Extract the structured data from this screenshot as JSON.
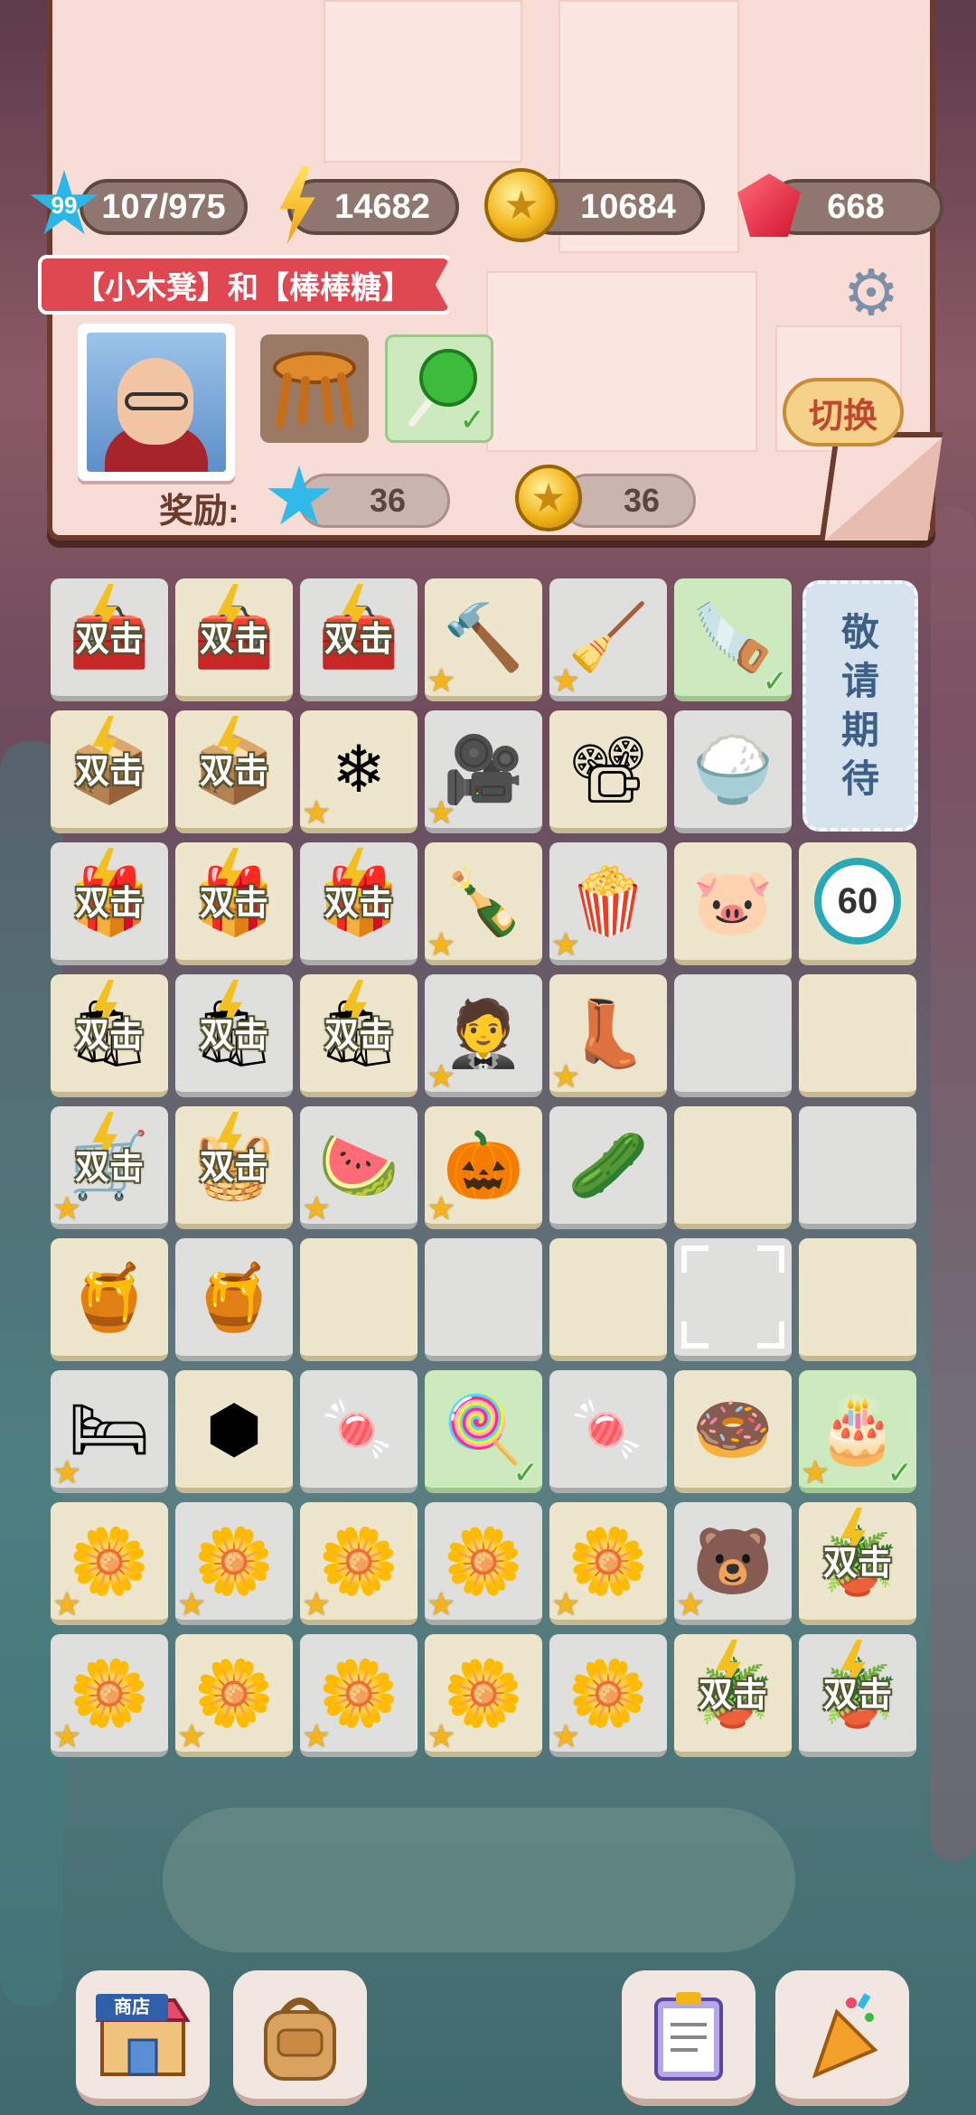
{
  "stats": {
    "level": "99",
    "xp": "107/975",
    "energy": "14682",
    "coins": "10684",
    "gems": "668"
  },
  "task": {
    "title": "【小木凳】和【棒棒糖】",
    "switch_label": "切换",
    "reward_label": "奖励:",
    "reward_xp": "36",
    "reward_coins": "36"
  },
  "board": {
    "double_label": "双击",
    "coming_soon": [
      "敬",
      "请",
      "期",
      "待"
    ],
    "timer_value": "60",
    "cells": [
      {
        "row": 0,
        "col": 0,
        "item": "toolbox-crate",
        "double": true,
        "bg": "grey"
      },
      {
        "row": 0,
        "col": 1,
        "item": "toolbox-crate",
        "double": true,
        "bg": "beige"
      },
      {
        "row": 0,
        "col": 2,
        "item": "toolbox-crate",
        "double": true,
        "bg": "grey"
      },
      {
        "row": 0,
        "col": 3,
        "item": "power-drill",
        "star": true,
        "bg": "beige"
      },
      {
        "row": 0,
        "col": 4,
        "item": "vacuum-cleaner",
        "star": true,
        "bg": "grey"
      },
      {
        "row": 0,
        "col": 5,
        "item": "hand-saw",
        "check": true,
        "bg": "green"
      },
      {
        "row": 1,
        "col": 0,
        "item": "electronics-crate",
        "double": true,
        "bg": "beige"
      },
      {
        "row": 1,
        "col": 1,
        "item": "electronics-crate",
        "double": true,
        "bg": "beige"
      },
      {
        "row": 1,
        "col": 2,
        "item": "air-conditioner",
        "star": true,
        "bg": "beige"
      },
      {
        "row": 1,
        "col": 3,
        "item": "video-camera",
        "star": true,
        "bg": "grey"
      },
      {
        "row": 1,
        "col": 4,
        "item": "projector",
        "bg": "beige"
      },
      {
        "row": 1,
        "col": 5,
        "item": "rice-cooker",
        "bg": "grey"
      },
      {
        "row": 2,
        "col": 0,
        "item": "snack-box",
        "double": true,
        "bg": "grey"
      },
      {
        "row": 2,
        "col": 1,
        "item": "snack-box",
        "double": true,
        "bg": "beige"
      },
      {
        "row": 2,
        "col": 2,
        "item": "snack-box",
        "double": true,
        "bg": "grey"
      },
      {
        "row": 2,
        "col": 3,
        "item": "champagne-bottles",
        "star": true,
        "bg": "beige"
      },
      {
        "row": 2,
        "col": 4,
        "item": "popcorn",
        "star": true,
        "bg": "grey"
      },
      {
        "row": 2,
        "col": 5,
        "item": "piggy-bank",
        "bg": "beige"
      },
      {
        "row": 2,
        "col": 6,
        "item": "timer",
        "bg": "beige"
      },
      {
        "row": 3,
        "col": 0,
        "item": "shopping-bags",
        "double": true,
        "bg": "beige"
      },
      {
        "row": 3,
        "col": 1,
        "item": "shopping-bags",
        "double": true,
        "bg": "grey"
      },
      {
        "row": 3,
        "col": 2,
        "item": "shopping-bags",
        "double": true,
        "bg": "beige"
      },
      {
        "row": 3,
        "col": 3,
        "item": "suit",
        "star": true,
        "bg": "grey"
      },
      {
        "row": 3,
        "col": 4,
        "item": "boots",
        "star": true,
        "bg": "beige"
      },
      {
        "row": 3,
        "col": 5,
        "item": "empty",
        "bg": "grey"
      },
      {
        "row": 3,
        "col": 6,
        "item": "empty",
        "bg": "beige"
      },
      {
        "row": 4,
        "col": 0,
        "item": "shopping-cart",
        "double": true,
        "star": true,
        "bg": "grey"
      },
      {
        "row": 4,
        "col": 1,
        "item": "vegetable-basket",
        "double": true,
        "bg": "beige"
      },
      {
        "row": 4,
        "col": 2,
        "item": "watermelon",
        "star": true,
        "bg": "grey"
      },
      {
        "row": 4,
        "col": 3,
        "item": "pumpkin",
        "star": true,
        "bg": "beige"
      },
      {
        "row": 4,
        "col": 4,
        "item": "cucumber",
        "bg": "grey"
      },
      {
        "row": 4,
        "col": 5,
        "item": "empty",
        "bg": "beige"
      },
      {
        "row": 4,
        "col": 6,
        "item": "empty",
        "bg": "grey"
      },
      {
        "row": 5,
        "col": 0,
        "item": "honeycomb-pieces",
        "bg": "beige"
      },
      {
        "row": 5,
        "col": 1,
        "item": "honey-jar",
        "bg": "grey"
      },
      {
        "row": 5,
        "col": 2,
        "item": "empty",
        "bg": "beige"
      },
      {
        "row": 5,
        "col": 3,
        "item": "empty",
        "bg": "grey"
      },
      {
        "row": 5,
        "col": 4,
        "item": "empty",
        "bg": "beige"
      },
      {
        "row": 5,
        "col": 5,
        "item": "selected",
        "bg": "grey"
      },
      {
        "row": 5,
        "col": 6,
        "item": "empty",
        "bg": "beige"
      },
      {
        "row": 6,
        "col": 0,
        "item": "bed",
        "star": true,
        "bg": "grey"
      },
      {
        "row": 6,
        "col": 1,
        "item": "honeycomb",
        "bg": "beige"
      },
      {
        "row": 6,
        "col": 2,
        "item": "jelly-beans",
        "bg": "grey"
      },
      {
        "row": 6,
        "col": 3,
        "item": "lollipop",
        "check": true,
        "bg": "green"
      },
      {
        "row": 6,
        "col": 4,
        "item": "candy-cane",
        "bg": "grey"
      },
      {
        "row": 6,
        "col": 5,
        "item": "donut",
        "bg": "beige"
      },
      {
        "row": 6,
        "col": 6,
        "item": "cake",
        "star": true,
        "check": true,
        "bg": "green"
      },
      {
        "row": 7,
        "col": 0,
        "item": "flower-generator",
        "star": true,
        "bg": "beige"
      },
      {
        "row": 7,
        "col": 1,
        "item": "flower-generator",
        "star": true,
        "bg": "grey"
      },
      {
        "row": 7,
        "col": 2,
        "item": "flower-generator",
        "star": true,
        "bg": "beige"
      },
      {
        "row": 7,
        "col": 3,
        "item": "flower-generator",
        "star": true,
        "bg": "grey"
      },
      {
        "row": 7,
        "col": 4,
        "item": "flower-generator",
        "star": true,
        "bg": "beige"
      },
      {
        "row": 7,
        "col": 5,
        "item": "bear",
        "star": true,
        "bg": "grey"
      },
      {
        "row": 7,
        "col": 6,
        "item": "flower-pot",
        "double": true,
        "bg": "beige"
      },
      {
        "row": 8,
        "col": 0,
        "item": "flower-generator",
        "star": true,
        "bg": "grey"
      },
      {
        "row": 8,
        "col": 1,
        "item": "flower-generator",
        "star": true,
        "bg": "beige"
      },
      {
        "row": 8,
        "col": 2,
        "item": "flower-generator",
        "star": true,
        "bg": "grey"
      },
      {
        "row": 8,
        "col": 3,
        "item": "flower-generator",
        "star": true,
        "bg": "beige"
      },
      {
        "row": 8,
        "col": 4,
        "item": "flower-generator",
        "star": true,
        "bg": "grey"
      },
      {
        "row": 8,
        "col": 5,
        "item": "flower-pot",
        "double": true,
        "bg": "beige"
      },
      {
        "row": 8,
        "col": 6,
        "item": "flower-pot",
        "double": true,
        "bg": "grey"
      }
    ]
  },
  "bottom_bar": {
    "shop_sign": "商店"
  }
}
